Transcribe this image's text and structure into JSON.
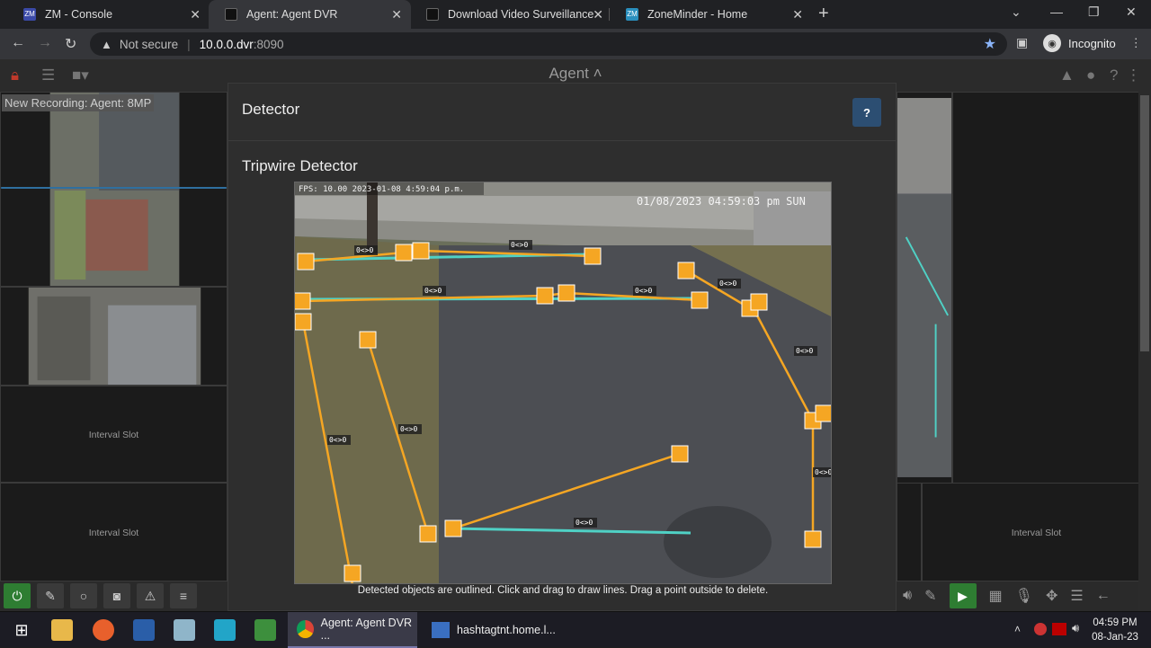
{
  "browser": {
    "tabs": [
      {
        "title": "ZM - Console",
        "favicon_color": "#3b4aa8"
      },
      {
        "title": "Agent: Agent DVR",
        "favicon_color": "#444444"
      },
      {
        "title": "Download Video Surveillance Sof",
        "favicon_color": "#444444"
      },
      {
        "title": "ZoneMinder - Home",
        "favicon_color": "#2a8fbd"
      }
    ],
    "url_warning": "Not secure",
    "url_host": "10.0.0.dvr",
    "url_port": ":8090",
    "profile": "Incognito"
  },
  "app": {
    "title": "Agent",
    "recording_badge": "New Recording: Agent: 8MP",
    "slots": [
      "Interval Slot",
      "Interval Slot",
      "Interval Slot"
    ]
  },
  "modal": {
    "title": "Detector",
    "help_label": "?",
    "section_title": "Tripwire Detector",
    "caption": "Detected objects are outlined. Click and drag to draw lines. Drag a point outside to delete.",
    "osd_left": "FPS: 10.00 2023-01-08 4:59:04 p.m.",
    "osd_right": "01/08/2023 04:59:03 pm SUN",
    "line_labels": [
      "0<>0",
      "0<>0",
      "0<>0",
      "0<>0",
      "0<>0",
      "0<>0",
      "0<>0",
      "0<>0",
      "0<>0",
      "0<>0"
    ]
  },
  "taskbar": {
    "active_app": "Agent: Agent DVR ...",
    "second_app": "hashtagtnt.home.l...",
    "time": "04:59 PM",
    "date": "08-Jan-23"
  },
  "colors": {
    "wire_orange": "#f5a623",
    "wire_cyan": "#4fd1c5",
    "help_blue": "#2c4e72"
  }
}
